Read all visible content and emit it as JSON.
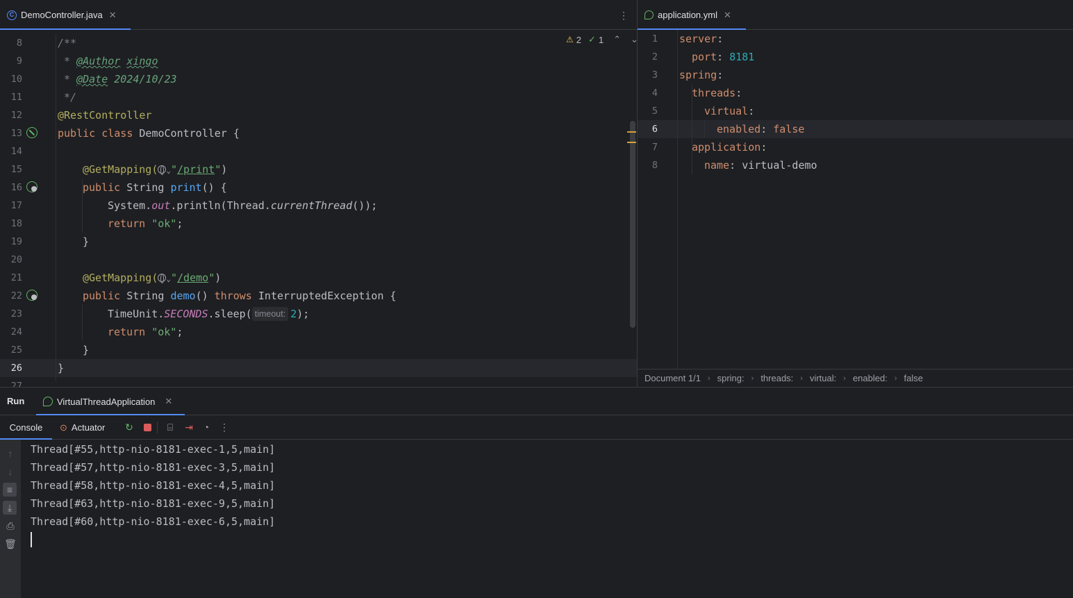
{
  "left_editor": {
    "tab": {
      "label": "DemoController.java",
      "icon": "java-class-icon"
    },
    "inspections": {
      "warnings": "2",
      "weak_warnings": "1"
    },
    "lines": [
      {
        "n": "8",
        "code": "/**"
      },
      {
        "n": "9",
        "code": " * @Author xingo"
      },
      {
        "n": "10",
        "code": " * @Date 2024/10/23"
      },
      {
        "n": "11",
        "code": " */"
      },
      {
        "n": "12",
        "code": "@RestController"
      },
      {
        "n": "13",
        "code": "public class DemoController {"
      },
      {
        "n": "14",
        "code": ""
      },
      {
        "n": "15",
        "code": "    @GetMapping(\"/print\")"
      },
      {
        "n": "16",
        "code": "    public String print() {"
      },
      {
        "n": "17",
        "code": "        System.out.println(Thread.currentThread());"
      },
      {
        "n": "18",
        "code": "        return \"ok\";"
      },
      {
        "n": "19",
        "code": "    }"
      },
      {
        "n": "20",
        "code": ""
      },
      {
        "n": "21",
        "code": "    @GetMapping(\"/demo\")"
      },
      {
        "n": "22",
        "code": "    public String demo() throws InterruptedException {"
      },
      {
        "n": "23",
        "code": "        TimeUnit.SECONDS.sleep(2);"
      },
      {
        "n": "24",
        "code": "        return \"ok\";"
      },
      {
        "n": "25",
        "code": "    }"
      },
      {
        "n": "26",
        "code": "}"
      },
      {
        "n": "27",
        "code": ""
      }
    ],
    "tokens": {
      "author_tag": "@Author",
      "author_val": "xingo",
      "date_tag": "@Date",
      "date_val": "2024/10/23",
      "rest_controller": "@RestController",
      "public": "public",
      "class": "class",
      "class_name": "DemoController {",
      "get_mapping": "@GetMapping(",
      "print_path": "/print",
      "demo_path": "/demo",
      "string": "String",
      "print_fn": "print",
      "demo_fn": "demo",
      "system": "System.",
      "out": "out",
      "println": ".println(Thread.",
      "current_thread": "currentThread",
      "println_end": "());",
      "return": "return",
      "ok": "\"ok\"",
      "throws": "throws",
      "exception": "InterruptedException {",
      "timeunit": "TimeUnit.",
      "seconds": "SECONDS",
      "sleep": ".sleep(",
      "timeout_hint": "timeout:",
      "sleep_arg": "2",
      "sleep_end": ");"
    }
  },
  "right_editor": {
    "tab": {
      "label": "application.yml",
      "icon": "spring-config-icon"
    },
    "lines": [
      {
        "n": "1",
        "key": "server",
        "value": "",
        "indent": 0
      },
      {
        "n": "2",
        "key": "port",
        "value": "8181",
        "indent": 1
      },
      {
        "n": "3",
        "key": "spring",
        "value": "",
        "indent": 0
      },
      {
        "n": "4",
        "key": "threads",
        "value": "",
        "indent": 1
      },
      {
        "n": "5",
        "key": "virtual",
        "value": "",
        "indent": 2
      },
      {
        "n": "6",
        "key": "enabled",
        "value": "false",
        "indent": 3
      },
      {
        "n": "7",
        "key": "application",
        "value": "",
        "indent": 1
      },
      {
        "n": "8",
        "key": "name",
        "value": "virtual-demo",
        "indent": 2
      }
    ],
    "breadcrumb": [
      "Document 1/1",
      "spring:",
      "threads:",
      "virtual:",
      "enabled:",
      "false"
    ]
  },
  "run_panel": {
    "title": "Run",
    "config_tab": "VirtualThreadApplication",
    "tabs": {
      "console": "Console",
      "actuator": "Actuator"
    },
    "output": [
      "Thread[#55,http-nio-8181-exec-1,5,main]",
      "Thread[#57,http-nio-8181-exec-3,5,main]",
      "Thread[#58,http-nio-8181-exec-4,5,main]",
      "Thread[#63,http-nio-8181-exec-9,5,main]",
      "Thread[#60,http-nio-8181-exec-6,5,main]"
    ]
  },
  "colors": {
    "accent": "#548af7",
    "background": "#1e1f22",
    "keyword": "#cf8e6d",
    "string": "#6aab73",
    "number": "#2aacb8"
  }
}
